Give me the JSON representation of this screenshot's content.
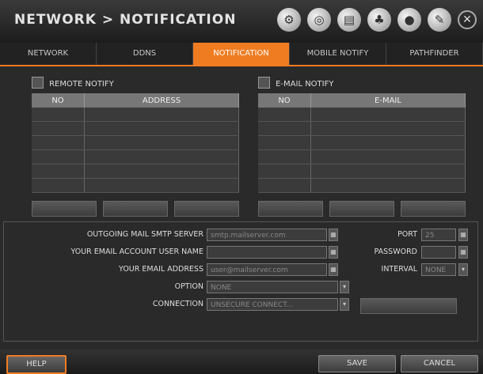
{
  "header": {
    "title": "NETWORK > NOTIFICATION"
  },
  "tabs": [
    {
      "label": "NETWORK"
    },
    {
      "label": "DDNS"
    },
    {
      "label": "NOTIFICATION"
    },
    {
      "label": "MOBILE NOTIFY"
    },
    {
      "label": "PATHFINDER"
    }
  ],
  "remote_notify": {
    "label": "REMOTE NOTIFY",
    "columns": [
      "NO",
      "ADDRESS"
    ]
  },
  "email_notify": {
    "label": "E-MAIL NOTIFY",
    "columns": [
      "NO",
      "E-MAIL"
    ]
  },
  "form": {
    "smtp_label": "OUTGOING MAIL SMTP SERVER",
    "smtp_value": "smtp.mailserver.com",
    "port_label": "PORT",
    "port_value": "25",
    "user_label": "YOUR EMAIL ACCOUNT USER NAME",
    "user_value": "",
    "password_label": "PASSWORD",
    "password_value": "",
    "address_label": "YOUR EMAIL ADDRESS",
    "address_value": "user@mailserver.com",
    "interval_label": "INTERVAL",
    "interval_value": "NONE",
    "option_label": "OPTION",
    "option_value": "NONE",
    "connection_label": "CONNECTION",
    "connection_value": "UNSECURE CONNECT..."
  },
  "footer": {
    "help": "HELP",
    "save": "SAVE",
    "cancel": "CANCEL"
  },
  "colors": {
    "accent": "#f07c22"
  },
  "icons": [
    "gear-icon",
    "network-icon",
    "storage-icon",
    "system-icon",
    "globe-icon",
    "wrench-icon",
    "close-icon"
  ]
}
